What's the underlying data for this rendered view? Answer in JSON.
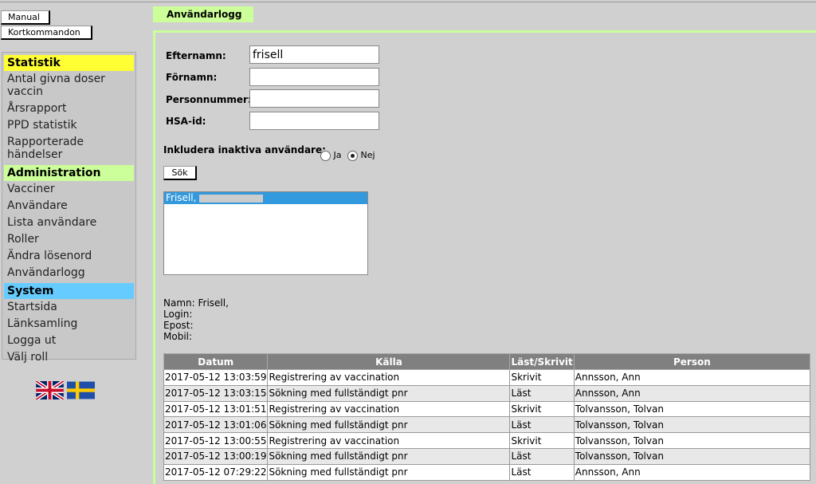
{
  "top_buttons": {
    "manual": "Manual",
    "shortcuts": "Kortkommandon"
  },
  "sidebar": {
    "statistik": {
      "title": "Statistik",
      "color": "#ffff33",
      "items": [
        "Antal givna doser vaccin",
        "Årsrapport",
        "PPD statistik",
        "Rapporterade händelser"
      ]
    },
    "administration": {
      "title": "Administration",
      "color": "#ccff99",
      "items": [
        "Vacciner",
        "Användare",
        "Lista användare",
        "Roller",
        "Ändra lösenord",
        "Användarlogg"
      ]
    },
    "system": {
      "title": "System",
      "color": "#66ccff",
      "items": [
        "Startsida",
        "Länksamling",
        "Logga ut",
        "Välj roll"
      ]
    }
  },
  "languages": [
    "english-flag",
    "swedish-flag"
  ],
  "tab": "Användarlogg",
  "form": {
    "efternamn": {
      "label": "Efternamn:",
      "value": "frisell"
    },
    "fornamn": {
      "label": "Förnamn:",
      "value": ""
    },
    "personnummer": {
      "label": "Personnummer:",
      "value": ""
    },
    "hsaid": {
      "label": "HSA-id:",
      "value": ""
    },
    "inactive_label": "Inkludera inaktiva användare:",
    "yes": "Ja",
    "no": "Nej",
    "selected": "Nej",
    "search": "Sök"
  },
  "results": [
    "Frisell,"
  ],
  "user_info": {
    "namn": "Namn: Frisell,",
    "login": "Login:",
    "epost": "Epost:",
    "mobil": "Mobil:"
  },
  "log_table": {
    "headers": [
      "Datum",
      "Källa",
      "Läst/Skrivit",
      "Person"
    ],
    "rows": [
      [
        "2017-05-12 13:03:59",
        "Registrering av vaccination",
        "Skrivit",
        "Annsson, Ann"
      ],
      [
        "2017-05-12 13:03:15",
        "Sökning med fullständigt pnr",
        "Läst",
        "Annsson, Ann"
      ],
      [
        "2017-05-12 13:01:51",
        "Registrering av vaccination",
        "Skrivit",
        "Tolvansson, Tolvan"
      ],
      [
        "2017-05-12 13:01:06",
        "Sökning med fullständigt pnr",
        "Läst",
        "Tolvansson, Tolvan"
      ],
      [
        "2017-05-12 13:00:55",
        "Registrering av vaccination",
        "Skrivit",
        "Tolvansson, Tolvan"
      ],
      [
        "2017-05-12 13:00:19",
        "Sökning med fullständigt pnr",
        "Läst",
        "Tolvansson, Tolvan"
      ],
      [
        "2017-05-12 07:29:22",
        "Sökning med fullständigt pnr",
        "Läst",
        "Annsson, Ann"
      ]
    ]
  }
}
